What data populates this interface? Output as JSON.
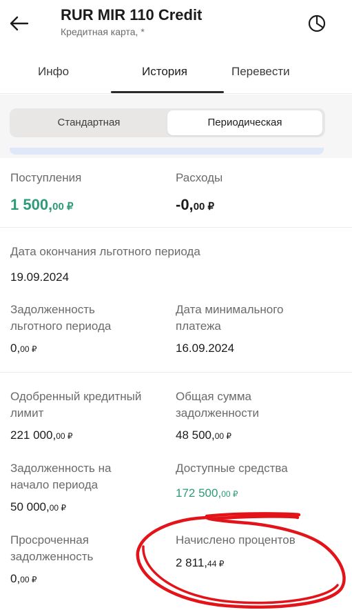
{
  "header": {
    "title": "RUR MIR 110 Credit",
    "subtitle": "Кредитная карта, *"
  },
  "tabs": [
    {
      "label": "Инфо"
    },
    {
      "label": "История"
    },
    {
      "label": "Перевести"
    }
  ],
  "segments": [
    {
      "label": "Стандартная"
    },
    {
      "label": "Периодическая"
    }
  ],
  "summary": {
    "income_label": "Поступления",
    "income_int": "1 500,",
    "income_cents": "00 ₽",
    "expense_label": "Расходы",
    "expense_int": "-0,",
    "expense_cents": "00 ₽"
  },
  "grace": {
    "end_label": "Дата окончания льготного периода",
    "end_value": "19.09.2024",
    "debt_label_1": "Задолженность",
    "debt_label_2": "льготного периода",
    "debt_int": "0,",
    "debt_cents": "00 ₽",
    "min_label_1": "Дата минимального",
    "min_label_2": "платежа",
    "min_value": "16.09.2024"
  },
  "credit": {
    "limit_label_1": "Одобренный кредитный",
    "limit_label_2": "лимит",
    "limit_int": "221 000,",
    "limit_cents": "00 ₽",
    "total_label_1": "Общая сумма",
    "total_label_2": "задолженности",
    "total_int": "48 500,",
    "total_cents": "00 ₽",
    "start_label_1": "Задолженность на",
    "start_label_2": "начало периода",
    "start_int": "50 000,",
    "start_cents": "00 ₽",
    "avail_label": "Доступные средства",
    "avail_int": "172 500,",
    "avail_cents": "00 ₽",
    "overdue_label_1": "Просроченная",
    "overdue_label_2": "задолженность",
    "overdue_int": "0,",
    "overdue_cents": "00 ₽",
    "interest_label": "Начислено процентов",
    "interest_int": "2 811,",
    "interest_cents": "44 ₽"
  },
  "colors": {
    "accent_green": "#2e9a78",
    "annotation_red": "#e2141a",
    "info_bar": "#dfe8f8"
  },
  "icons": {
    "back": "arrow-left-icon",
    "stats": "pie-chart-icon"
  }
}
